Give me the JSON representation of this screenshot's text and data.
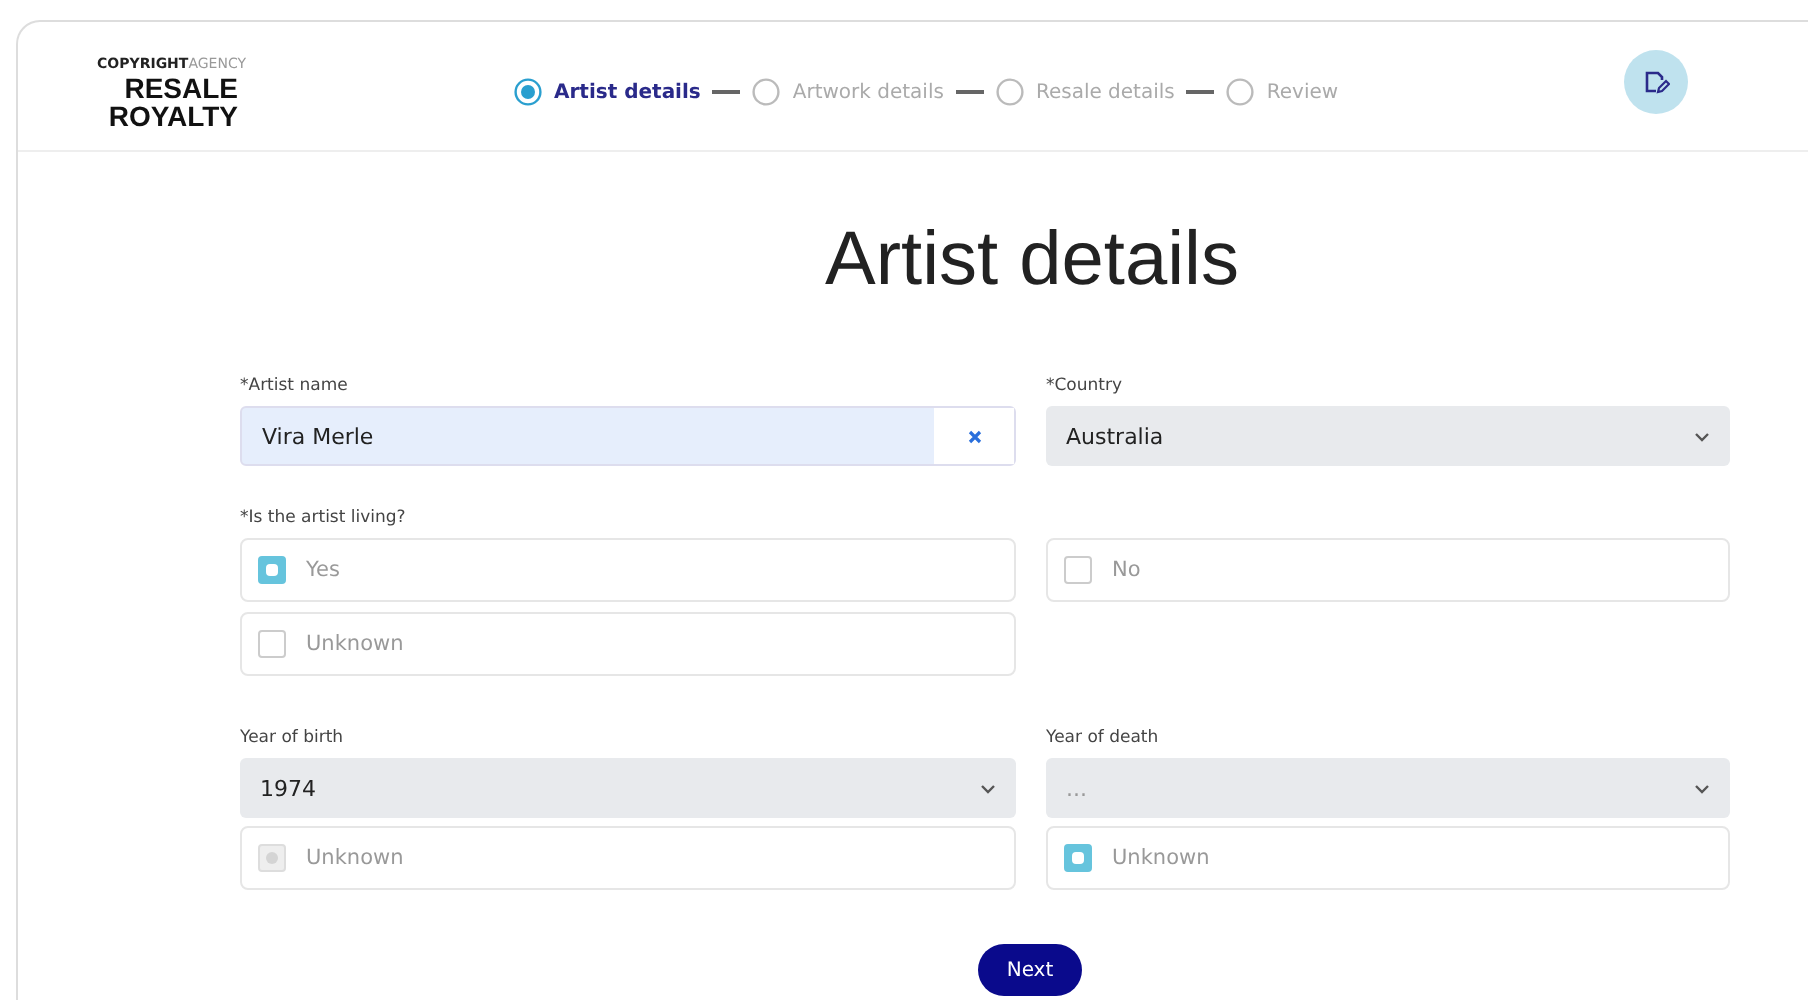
{
  "logo": {
    "line_1a": "COPYRIGHT",
    "line_1b": "AGENCY",
    "line_2": "RESALE",
    "line_3": "ROYALTY"
  },
  "steps": [
    {
      "label": "Artist details",
      "selected": true
    },
    {
      "label": "Artwork details",
      "selected": false
    },
    {
      "label": "Resale details",
      "selected": false
    },
    {
      "label": "Review",
      "selected": false
    }
  ],
  "page_title": "Artist details",
  "artist_name": {
    "label": "*Artist name",
    "value": "Vira Merle"
  },
  "country": {
    "label": "*Country",
    "value": "Australia"
  },
  "living": {
    "label": "*Is the artist living?",
    "options": [
      {
        "label": "Yes",
        "checked": true
      },
      {
        "label": "No",
        "checked": false
      },
      {
        "label": "Unknown",
        "checked": false
      }
    ]
  },
  "year_of_birth": {
    "label": "Year of birth",
    "value": "1974",
    "unknown": {
      "label": "Unknown",
      "checked": true,
      "disabled": true
    }
  },
  "year_of_death": {
    "label": "Year of death",
    "placeholder": "...",
    "unknown": {
      "label": "Unknown",
      "checked": true,
      "disabled": false
    }
  },
  "next_button": "Next"
}
